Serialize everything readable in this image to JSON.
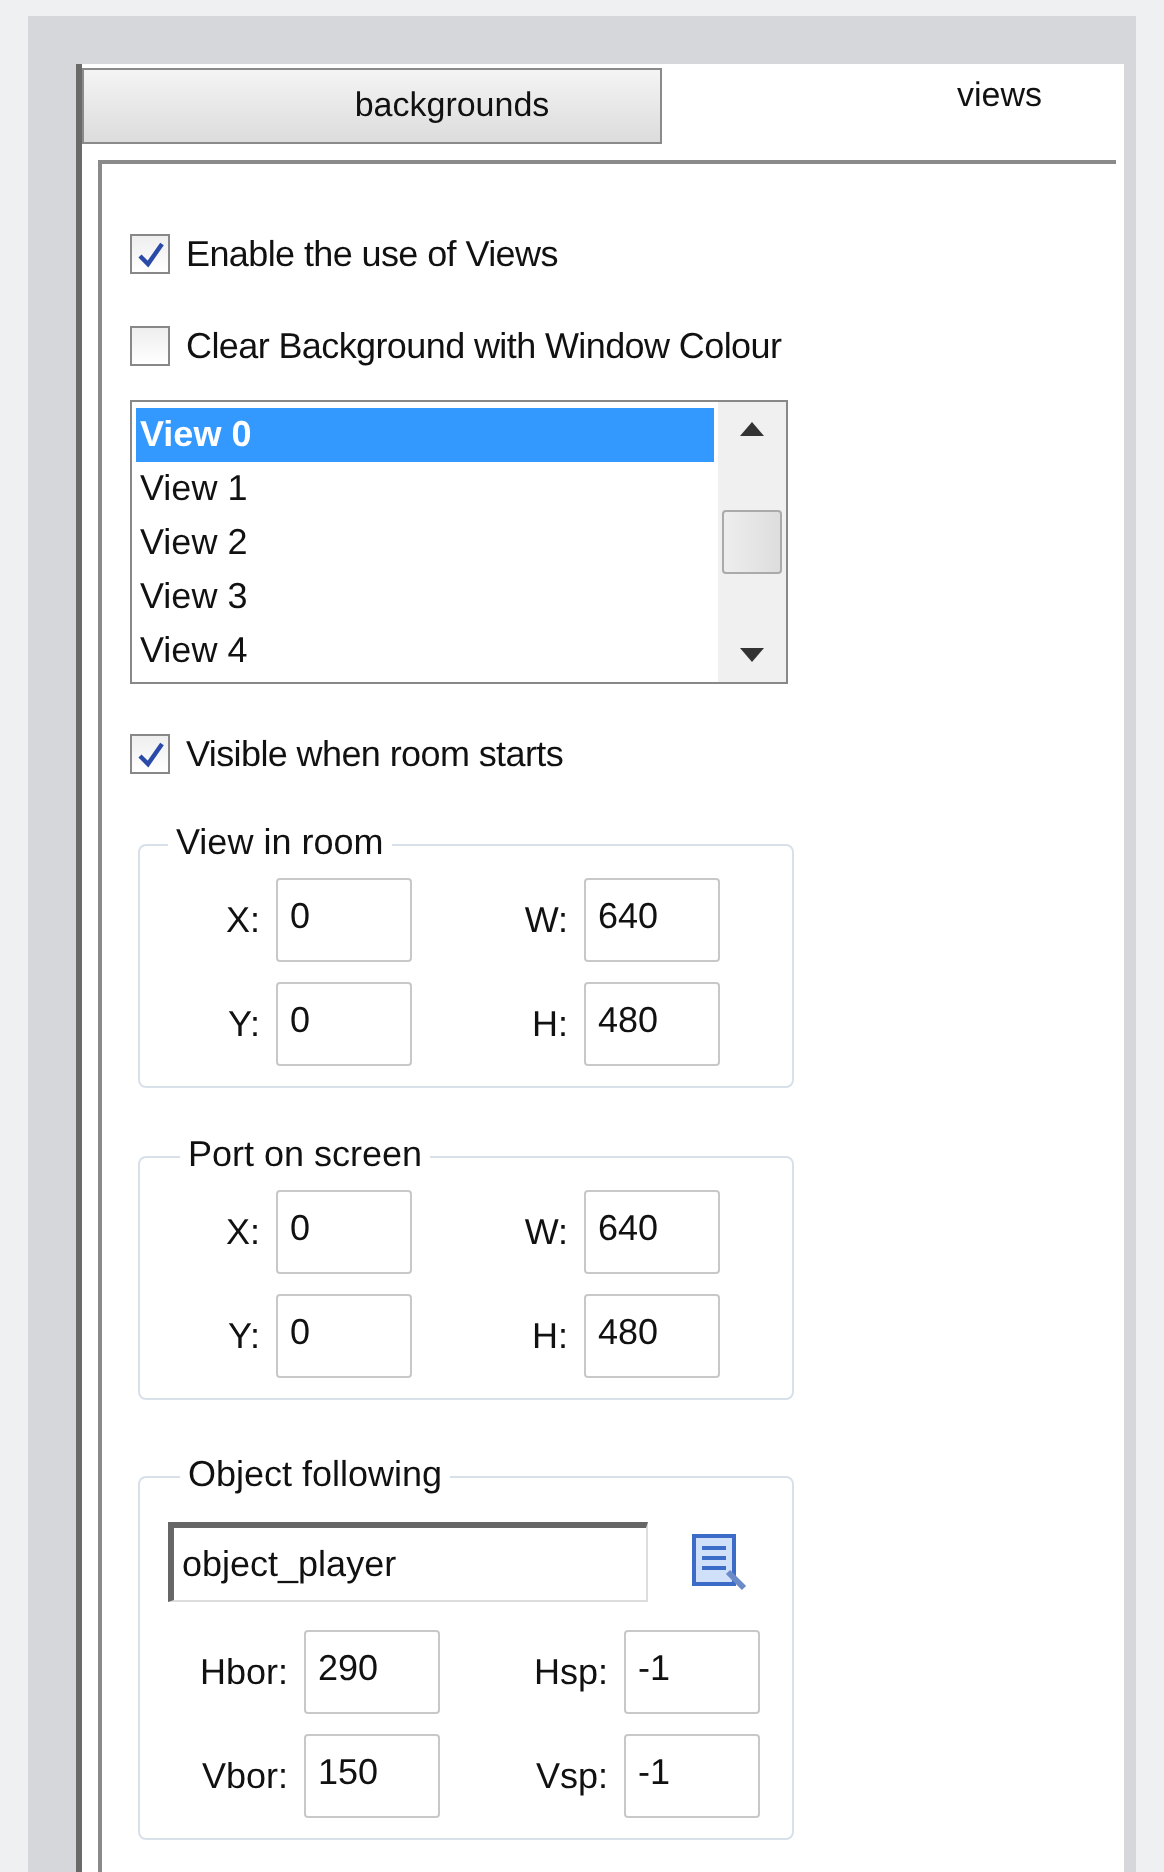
{
  "tabs": [
    {
      "label": "backgrounds",
      "selected": false
    },
    {
      "label": "views",
      "selected": true
    }
  ],
  "options": [
    {
      "label": "Enable the use of Views",
      "checked": true
    },
    {
      "label": "Clear Background with Window Colour",
      "checked": false
    }
  ],
  "views_list": [
    {
      "label": "View 0",
      "selected": true
    },
    {
      "label": "View 1",
      "selected": false
    },
    {
      "label": "View 2",
      "selected": false
    },
    {
      "label": "View 3",
      "selected": false
    },
    {
      "label": "View 4",
      "selected": false
    }
  ],
  "visible_option": {
    "label": "Visible when room starts",
    "checked": true
  },
  "groups": [
    {
      "title": "View in room",
      "fields": [
        {
          "label": "X:",
          "value": "0"
        },
        {
          "label": "W:",
          "value": "640"
        },
        {
          "label": "Y:",
          "value": "0"
        },
        {
          "label": "H:",
          "value": "480"
        }
      ]
    },
    {
      "title": "Port on screen",
      "fields": [
        {
          "label": "X:",
          "value": "0"
        },
        {
          "label": "W:",
          "value": "640"
        },
        {
          "label": "Y:",
          "value": "0"
        },
        {
          "label": "H:",
          "value": "480"
        }
      ]
    }
  ],
  "object_following": {
    "title": "Object following",
    "object": "object_player",
    "fields": [
      {
        "label": "Hbor:",
        "value": "290"
      },
      {
        "label": "Hsp:",
        "value": "-1"
      },
      {
        "label": "Vbor:",
        "value": "150"
      },
      {
        "label": "Vsp:",
        "value": "-1"
      }
    ]
  }
}
